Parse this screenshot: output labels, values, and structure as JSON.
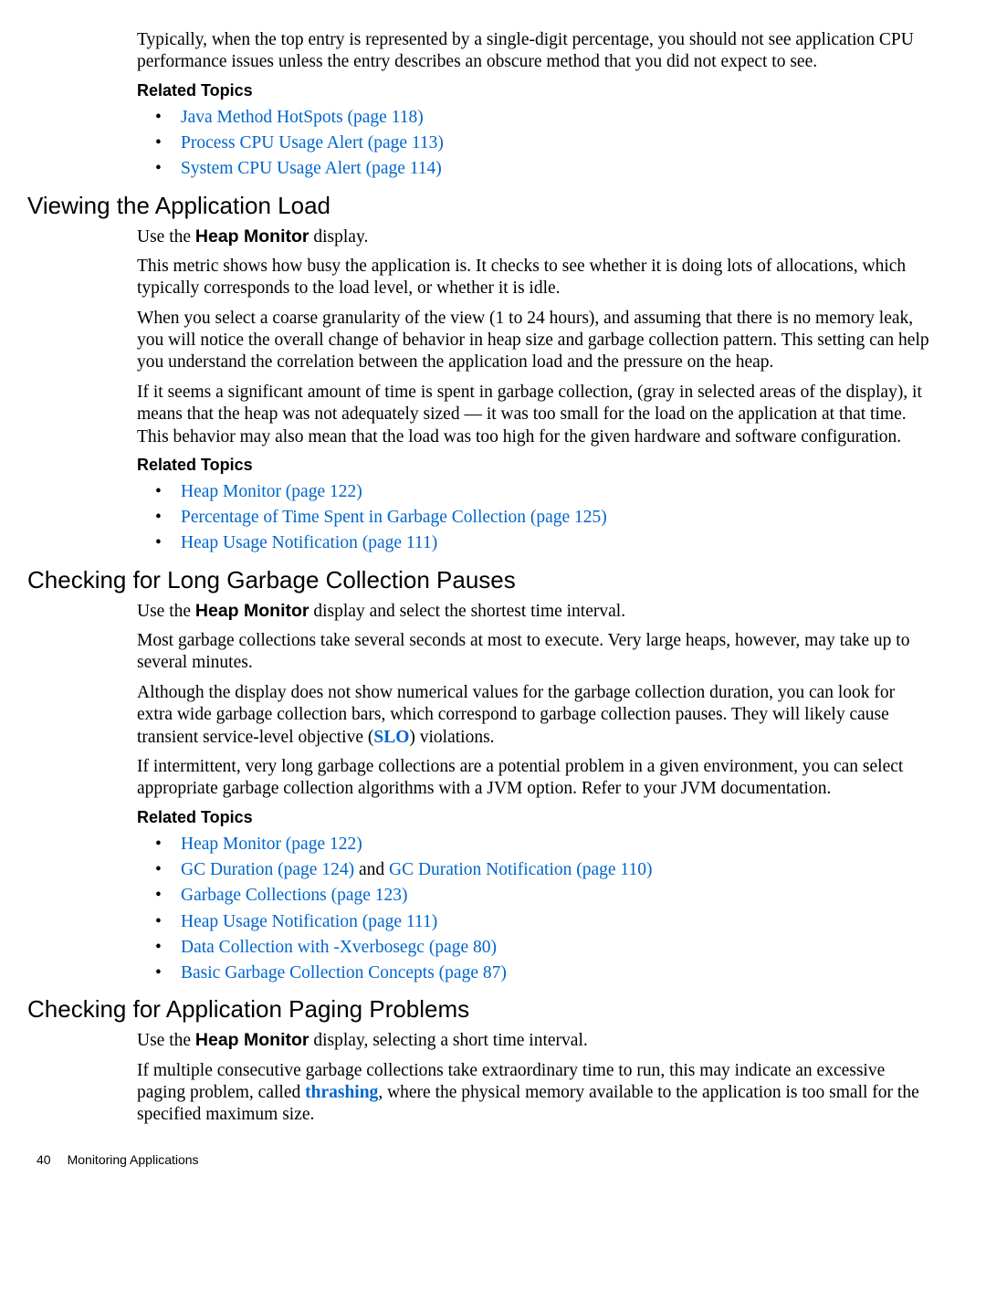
{
  "intro": {
    "para1": "Typically, when the top entry is represented by a single-digit percentage, you should not see application CPU performance issues unless the entry describes an obscure method that you did not expect to see.",
    "related_heading": "Related Topics",
    "bullets": [
      "Java Method HotSpots (page 118)",
      "Process CPU Usage Alert (page 113)",
      "System CPU Usage Alert (page 114)"
    ]
  },
  "sec1": {
    "heading": "Viewing the Application Load",
    "p1a": "Use the ",
    "p1b": "Heap Monitor",
    "p1c": " display.",
    "p2": "This metric shows how busy the application is. It checks to see whether it is doing lots of allocations, which typically corresponds to the load level, or whether it is idle.",
    "p3": "When you select a coarse granularity of the view (1 to 24 hours), and assuming that there is no memory leak, you will notice the overall change of behavior in heap size and garbage collection pattern. This setting can help you understand the correlation between the application load and the pressure on the heap.",
    "p4": "If it seems a significant amount of time is spent in garbage collection, (gray in selected areas of the display), it means that the heap was not adequately sized — it was too small for the load on the application at that time. This behavior may also mean that the load was too high for the given hardware and software configuration.",
    "related_heading": "Related Topics",
    "bullets": [
      "Heap Monitor (page 122)",
      "Percentage of Time Spent in Garbage Collection (page 125)",
      "Heap Usage Notification (page 111)"
    ]
  },
  "sec2": {
    "heading": "Checking for Long Garbage Collection Pauses",
    "p1a": "Use the ",
    "p1b": "Heap Monitor",
    "p1c": " display and select the shortest time interval.",
    "p2": "Most garbage collections take several seconds at most to execute. Very large heaps, however, may take up to several minutes.",
    "p3a": "Although the display does not show numerical values for the garbage collection duration, you can look for extra wide garbage collection bars, which correspond to garbage collection pauses. They will likely cause transient service-level objective (",
    "p3b": "SLO",
    "p3c": ") violations.",
    "p4": "If intermittent, very long garbage collections are a potential problem in a given environment, you can select appropriate garbage collection algorithms with a JVM option. Refer to your JVM documentation.",
    "related_heading": "Related Topics",
    "b1": "Heap Monitor (page 122)",
    "b2a": "GC Duration (page 124)",
    "b2b": " and ",
    "b2c": "GC Duration Notification (page 110)",
    "b3": "Garbage Collections (page 123)",
    "b4": "Heap Usage Notification (page 111)",
    "b5": "Data Collection with -Xverbosegc (page 80)",
    "b6": "Basic Garbage Collection Concepts (page 87)"
  },
  "sec3": {
    "heading": "Checking for Application Paging Problems",
    "p1a": "Use the ",
    "p1b": "Heap Monitor",
    "p1c": " display, selecting a short time interval.",
    "p2a": "If multiple consecutive garbage collections take extraordinary time to run, this may indicate an excessive paging problem, called ",
    "p2b": "thrashing",
    "p2c": ", where the physical memory available to the application is too small for the specified maximum size."
  },
  "footer": {
    "page": "40",
    "title": "Monitoring Applications"
  },
  "datanames": {
    "b2_and": "body-text"
  }
}
